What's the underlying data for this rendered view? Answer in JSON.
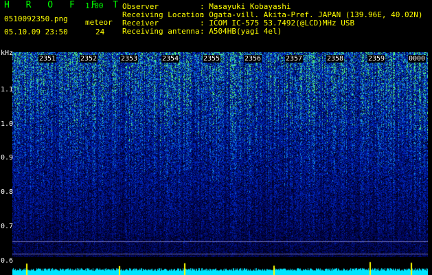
{
  "header": {
    "app_title": "H R O F F T",
    "version": "1.00",
    "filename": "0510092350.png",
    "meteor_label": "meteor",
    "datetime": "05.10.09 23:50",
    "meteor_count": "24"
  },
  "station": {
    "rows": [
      {
        "label": "Observer",
        "value": ": Masayuki Kobayashi"
      },
      {
        "label": "Receiving Location",
        "value": ": Ogata-vill. Akita-Pref. JAPAN (139.96E, 40.02N)"
      },
      {
        "label": "Receiver",
        "value": ": ICOM IC-575 53.7492(@LCD)MHz USB"
      },
      {
        "label": "Receiving antenna",
        "value": ": A504HB(yagi 4el)"
      }
    ]
  },
  "spectrogram": {
    "unit_label": "kHz",
    "freq_ticks": [
      "1.1",
      "1.0",
      "0.9",
      "0.8",
      "0.7",
      "0.6"
    ],
    "time_ticks": [
      "2351",
      "2352",
      "2353",
      "2354",
      "2355",
      "2356",
      "2357",
      "2358",
      "2359",
      "0000"
    ],
    "colors": {
      "background": "#000033",
      "noise": "#0033cc",
      "signal": "#66ff66",
      "strip": "#00e5ff"
    }
  }
}
